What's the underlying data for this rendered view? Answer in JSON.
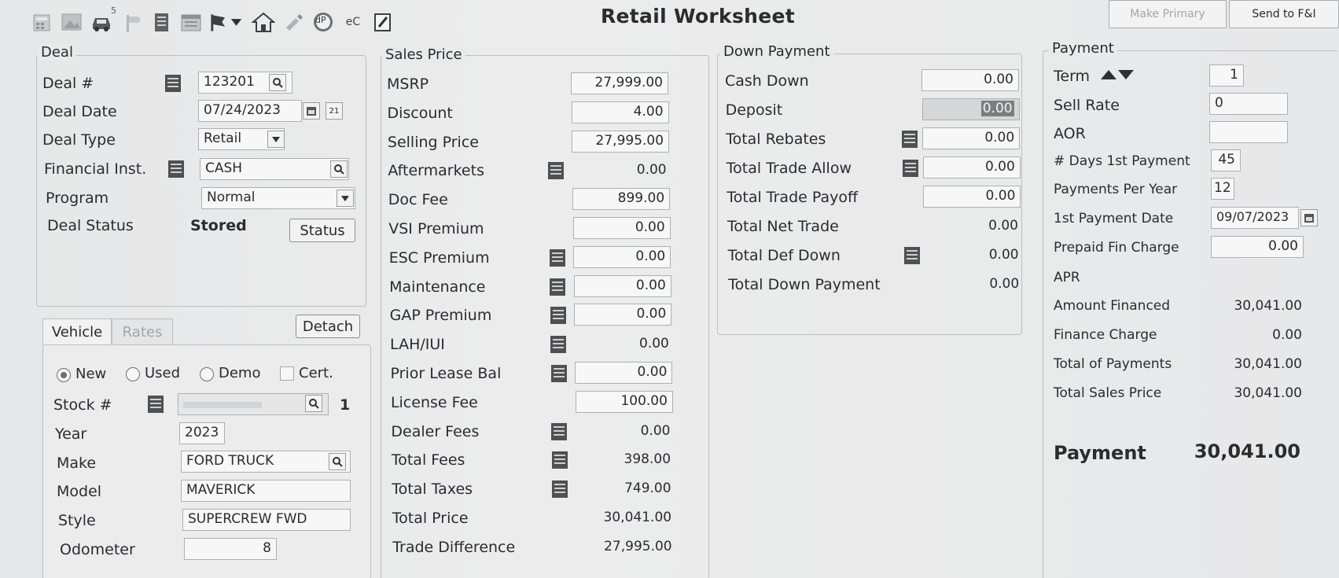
{
  "window": {
    "title": "Retail Worksheet"
  },
  "toolbar": {
    "icons": [
      "calculator-icon",
      "image-icon",
      "car-icon",
      "signpost-icon",
      "notebook-icon",
      "calendar-icon",
      "flag-dropdown-icon",
      "house-icon",
      "pencil-icon",
      "dp-icon",
      "ec-icon",
      "edit-icon"
    ],
    "icon_5_badge": "5",
    "dp_label": "dP",
    "ec_label": "eC",
    "make_primary": "Make Primary",
    "send_to_fi": "Send to F&I"
  },
  "deal": {
    "title": "Deal",
    "deal_no_label": "Deal #",
    "deal_no": "123201",
    "deal_date_label": "Deal Date",
    "deal_date": "07/24/2023",
    "calendar_badge": "21",
    "deal_type_label": "Deal Type",
    "deal_type": "Retail",
    "fin_inst_label": "Financial Inst.",
    "fin_inst": "CASH",
    "program_label": "Program",
    "program": "Normal",
    "status_label": "Deal Status",
    "status_value": "Stored",
    "status_button": "Status"
  },
  "vehicle": {
    "tab_vehicle": "Vehicle",
    "tab_rates": "Rates",
    "detach": "Detach",
    "radio_new": "New",
    "radio_used": "Used",
    "radio_demo": "Demo",
    "cert": "Cert.",
    "stock_label": "Stock #",
    "stock_count": "1",
    "year_label": "Year",
    "year": "2023",
    "make_label": "Make",
    "make": "FORD TRUCK",
    "model_label": "Model",
    "model": "MAVERICK",
    "style_label": "Style",
    "style": "SUPERCREW FWD",
    "odometer_label": "Odometer",
    "odometer": "8"
  },
  "sales_price": {
    "title": "Sales Price",
    "rows": [
      {
        "label": "MSRP",
        "value": "27,999.00"
      },
      {
        "label": "Discount",
        "value": "4.00"
      },
      {
        "label": "Selling Price",
        "value": "27,995.00"
      },
      {
        "label": "Aftermarkets",
        "value": "0.00"
      },
      {
        "label": "Doc Fee",
        "value": "899.00"
      },
      {
        "label": "VSI Premium",
        "value": "0.00"
      },
      {
        "label": "ESC Premium",
        "value": "0.00"
      },
      {
        "label": "Maintenance",
        "value": "0.00"
      },
      {
        "label": "GAP Premium",
        "value": "0.00"
      },
      {
        "label": "LAH/IUI",
        "value": "0.00"
      },
      {
        "label": "Prior Lease Bal",
        "value": "0.00"
      },
      {
        "label": "License Fee",
        "value": "100.00"
      },
      {
        "label": "Dealer Fees",
        "value": "0.00"
      },
      {
        "label": "Total Fees",
        "value": "398.00"
      },
      {
        "label": "Total Taxes",
        "value": "749.00"
      },
      {
        "label": "Total Price",
        "value": "30,041.00"
      },
      {
        "label": "Trade Difference",
        "value": "27,995.00"
      }
    ]
  },
  "down_payment": {
    "title": "Down Payment",
    "rows": [
      {
        "label": "Cash Down",
        "value": "0.00"
      },
      {
        "label": "Deposit",
        "value": "0.00"
      },
      {
        "label": "Total Rebates",
        "value": "0.00"
      },
      {
        "label": "Total Trade Allow",
        "value": "0.00"
      },
      {
        "label": "Total Trade Payoff",
        "value": "0.00"
      },
      {
        "label": "Total Net Trade",
        "value": "0.00"
      },
      {
        "label": "Total Def Down",
        "value": "0.00"
      },
      {
        "label": "Total Down Payment",
        "value": "0.00"
      }
    ]
  },
  "payment": {
    "title": "Payment",
    "term_label": "Term",
    "term": "1",
    "sell_rate_label": "Sell Rate",
    "sell_rate": "0",
    "aor_label": "AOR",
    "aor": "",
    "days_label": "# Days 1st Payment",
    "days": "45",
    "ppy_label": "Payments Per Year",
    "ppy": "12",
    "first_date_label": "1st Payment Date",
    "first_date": "09/07/2023",
    "prepaid_label": "Prepaid Fin Charge",
    "prepaid": "0.00",
    "apr_label": "APR",
    "amount_financed_label": "Amount Financed",
    "amount_financed": "30,041.00",
    "finance_charge_label": "Finance Charge",
    "finance_charge": "0.00",
    "total_payments_label": "Total of Payments",
    "total_payments": "30,041.00",
    "total_sales_label": "Total Sales Price",
    "total_sales": "30,041.00",
    "payment_label": "Payment",
    "payment_value": "30,041.00"
  }
}
